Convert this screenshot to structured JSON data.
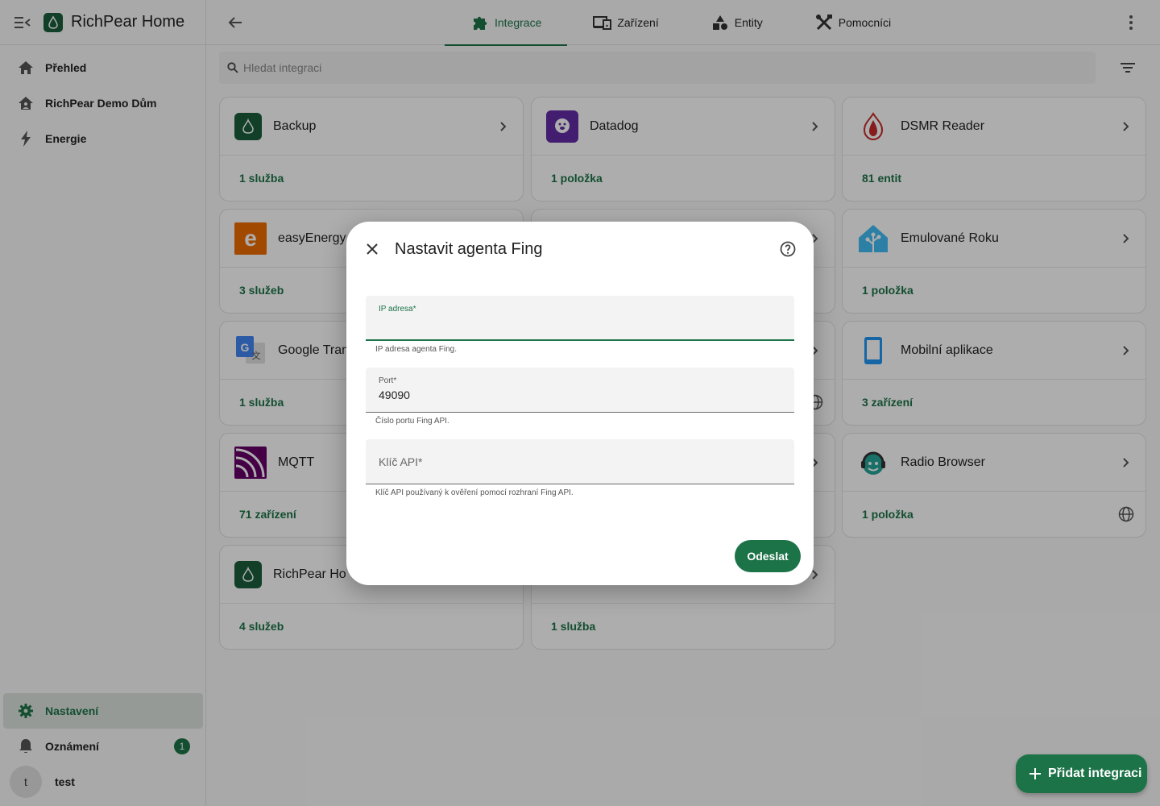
{
  "app": {
    "title": "RichPear Home"
  },
  "sidebar": {
    "items": [
      {
        "label": "Přehled"
      },
      {
        "label": "RichPear Demo Dům"
      },
      {
        "label": "Energie"
      }
    ],
    "bottom": {
      "settings_label": "Nastavení",
      "notifications_label": "Oznámení",
      "notifications_count": "1",
      "user_initial": "t",
      "user_name": "test"
    }
  },
  "tabs": [
    {
      "label": "Integrace",
      "icon": "puzzle-icon",
      "active": true
    },
    {
      "label": "Zařízení",
      "icon": "devices-icon"
    },
    {
      "label": "Entity",
      "icon": "shapes-icon"
    },
    {
      "label": "Pomocníci",
      "icon": "tools-icon"
    }
  ],
  "search": {
    "placeholder": "Hledat integraci"
  },
  "cards": [
    {
      "name": "Backup",
      "count": "1 služba"
    },
    {
      "name": "Datadog",
      "count": "1 položka"
    },
    {
      "name": "DSMR Reader",
      "count": "81 entit"
    },
    {
      "name": "easyEnergy",
      "count": "3 služeb"
    },
    {
      "name": "Emulované Roku",
      "count": "1 položka"
    },
    {
      "name": "Google Tran",
      "count": "1 služba"
    },
    {
      "name": "Mobilní aplikace",
      "count": "3 zařízení"
    },
    {
      "name": "MQTT",
      "count": "71 zařízení"
    },
    {
      "name": "Radio Browser",
      "count": "1 položka"
    },
    {
      "name": "RichPear Ho",
      "count": "4 služeb"
    },
    {
      "name": "",
      "count": "1 služba"
    }
  ],
  "fab": {
    "label": "Přidat integraci"
  },
  "dialog": {
    "title": "Nastavit agenta Fing",
    "fields": [
      {
        "label": "IP adresa*",
        "value": "",
        "helper": "IP adresa agenta Fing."
      },
      {
        "label": "Port*",
        "value": "49090",
        "helper": "Číslo portu Fing API."
      },
      {
        "label": "Klíč API*",
        "value": "",
        "helper": "Klíč API používaný k ověření pomocí rozhraní Fing API."
      }
    ],
    "submit_label": "Odeslat"
  },
  "colors": {
    "accent": "#1d7348",
    "scrim": "rgba(0,0,0,0.32)"
  }
}
